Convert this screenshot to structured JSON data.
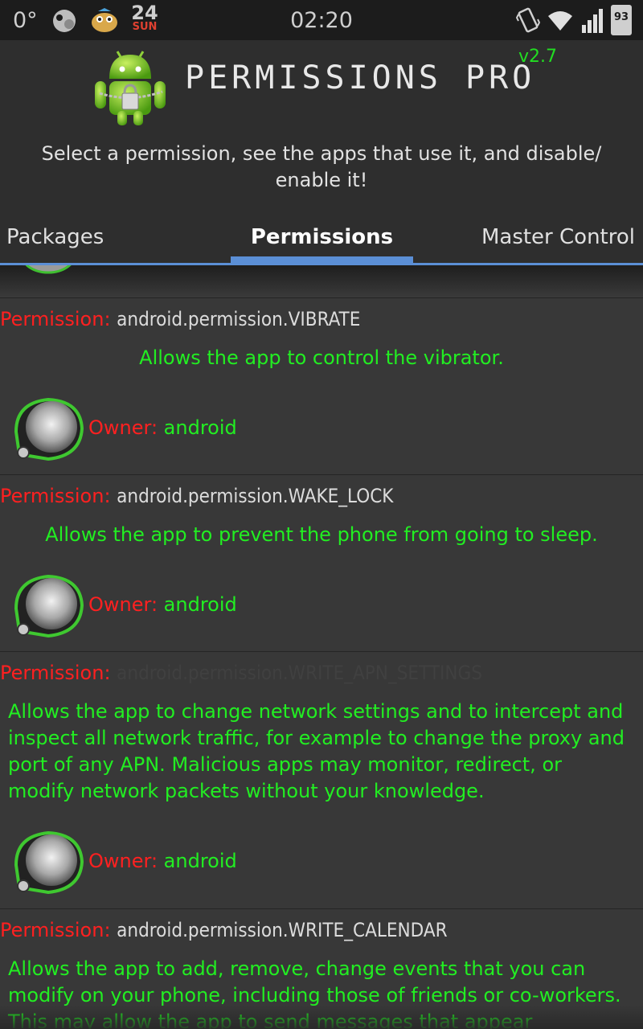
{
  "status_bar": {
    "temperature": "0°",
    "date_day": "24",
    "date_weekday": "SUN",
    "time": "02:20",
    "battery": "93",
    "icons": [
      "weather-icon",
      "game-icon",
      "vibrate-icon",
      "wifi-icon",
      "signal-icon",
      "battery-icon"
    ]
  },
  "header": {
    "title": "PERMISSIONS PRO",
    "version": "v2.7",
    "subtitle": "Select a permission, see the apps that use it, and disable/ enable it!"
  },
  "tabs": [
    {
      "label": "Packages",
      "active": false
    },
    {
      "label": "Permissions",
      "active": true
    },
    {
      "label": "Master Control",
      "active": false
    }
  ],
  "list": {
    "permission_label": "Permission:",
    "owner_label": "Owner:",
    "items": [
      {
        "permission": "android.permission.VIBRATE",
        "description": "Allows the app to control the vibrator.",
        "owner": "android"
      },
      {
        "permission": "android.permission.WAKE_LOCK",
        "description": "Allows the app to prevent the phone from going to sleep.",
        "owner": "android"
      },
      {
        "permission": "android.permission.WRITE_APN_SETTINGS",
        "description": "Allows the app to change network settings and to intercept and inspect all network traffic, for example to change the proxy and port of any APN. Malicious apps may monitor, redirect, or modify network packets without your knowledge.",
        "owner": "android"
      },
      {
        "permission": "android.permission.WRITE_CALENDAR",
        "description": "Allows the app to add, remove, change events that you can modify on your phone, including those of friends or co-workers. This may allow the app to send messages that appear"
      }
    ]
  },
  "colors": {
    "accent": "#5b8fd6",
    "permission_label": "#ff2020",
    "description": "#22ee22",
    "background": "#383838"
  }
}
